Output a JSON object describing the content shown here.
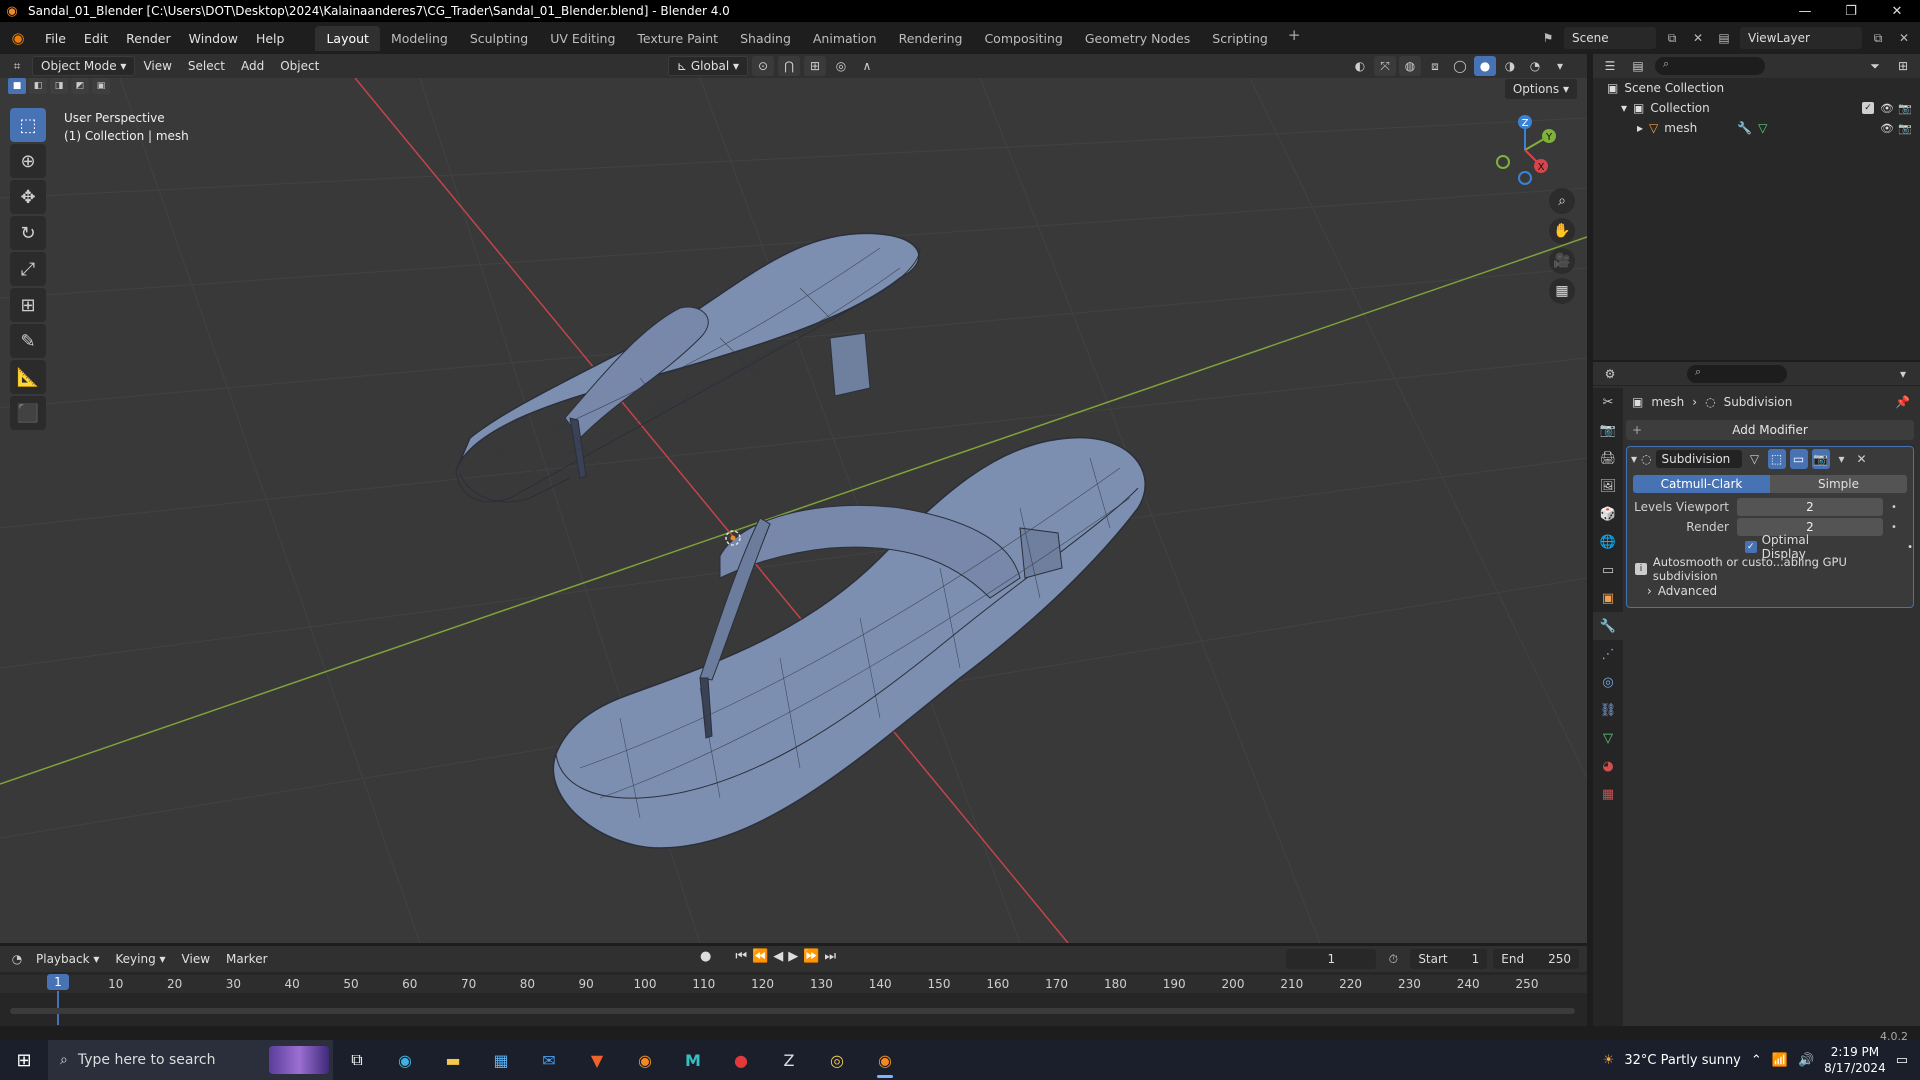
{
  "window": {
    "title": "Sandal_01_Blender [C:\\Users\\DOT\\Desktop\\2024\\Kalainaanderes7\\CG_Trader\\Sandal_01_Blender.blend] - Blender 4.0"
  },
  "menu": {
    "items": [
      "File",
      "Edit",
      "Render",
      "Window",
      "Help"
    ],
    "workspaces": [
      "Layout",
      "Modeling",
      "Sculpting",
      "UV Editing",
      "Texture Paint",
      "Shading",
      "Animation",
      "Rendering",
      "Compositing",
      "Geometry Nodes",
      "Scripting"
    ],
    "active_workspace": "Layout",
    "scene": "Scene",
    "view_layer": "ViewLayer"
  },
  "viewport_header": {
    "mode": "Object Mode",
    "menus": [
      "View",
      "Select",
      "Add",
      "Object"
    ],
    "orientation": "Global",
    "options": "Options"
  },
  "viewport": {
    "perspective": "User Perspective",
    "collection_info": "(1) Collection | mesh",
    "gizmo_labels": [
      "Z",
      "Y",
      "X"
    ],
    "colors": {
      "x_axis": "#d6454b",
      "y_axis": "#7fb13b",
      "z_axis": "#3b82d6",
      "mesh": "#7d8fb0",
      "wire": "#2a2f3a"
    }
  },
  "timeline": {
    "menus": [
      "Playback",
      "Keying",
      "View",
      "Marker"
    ],
    "current_frame": "1",
    "start_label": "Start",
    "start": "1",
    "end_label": "End",
    "end": "250",
    "ticks": [
      "1",
      "10",
      "20",
      "30",
      "40",
      "50",
      "60",
      "70",
      "80",
      "90",
      "100",
      "110",
      "120",
      "130",
      "140",
      "150",
      "160",
      "170",
      "180",
      "190",
      "200",
      "210",
      "220",
      "230",
      "240",
      "250"
    ]
  },
  "outliner": {
    "scene_collection": "Scene Collection",
    "collection": "Collection",
    "object": "mesh"
  },
  "properties": {
    "breadcrumb_object": "mesh",
    "breadcrumb_modifier": "Subdivision",
    "add_modifier": "Add Modifier",
    "modifier": {
      "name": "Subdivision",
      "type_options": [
        "Catmull-Clark",
        "Simple"
      ],
      "active_type": "Catmull-Clark",
      "levels_viewport_label": "Levels Viewport",
      "levels_viewport": "2",
      "render_label": "Render",
      "render": "2",
      "optimal_display_label": "Optimal Display",
      "optimal_display": true,
      "info": "Autosmooth or custo...abling GPU subdivision",
      "advanced": "Advanced"
    }
  },
  "status": {
    "version": "4.0.2"
  },
  "taskbar": {
    "search_placeholder": "Type here to search",
    "weather": "32°C  Partly sunny",
    "time": "2:19 PM",
    "date": "8/17/2024"
  }
}
